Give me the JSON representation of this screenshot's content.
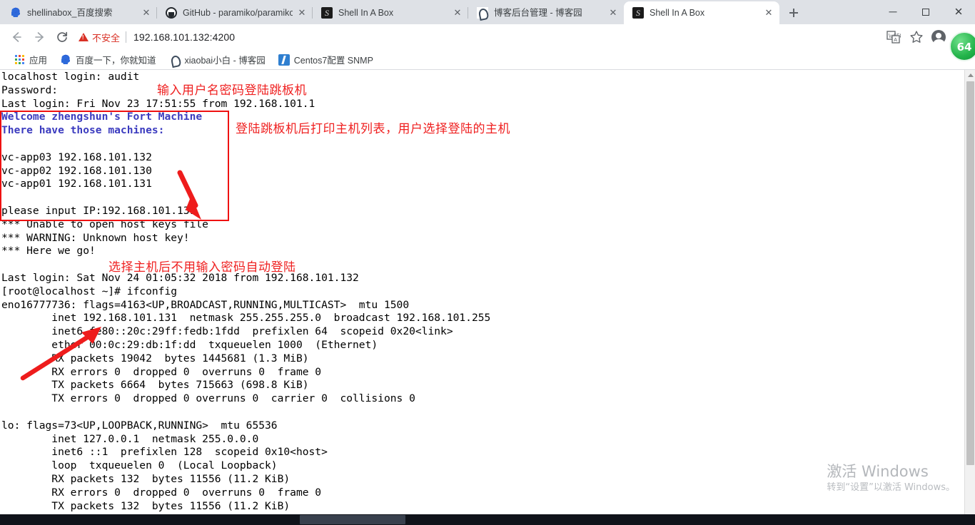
{
  "window": {
    "minimize_label": "—",
    "maximize_label": "❐",
    "close_label": "✕"
  },
  "tabs": [
    {
      "title": "shellinabox_百度搜索",
      "favicon": "baidu-icon",
      "active": false,
      "close_label": "✕"
    },
    {
      "title": "GitHub - paramiko/paramiko",
      "favicon": "github-icon",
      "active": false,
      "close_label": "✕"
    },
    {
      "title": "Shell In A Box",
      "favicon": "shellinabox-icon",
      "active": false,
      "close_label": "✕"
    },
    {
      "title": "博客后台管理 - 博客园",
      "favicon": "cnblogs-icon",
      "active": false,
      "close_label": "✕"
    },
    {
      "title": "Shell In A Box",
      "favicon": "shellinabox-icon",
      "active": true,
      "close_label": "✕"
    }
  ],
  "newtab_label": "+",
  "toolbar": {
    "back_label": "←",
    "forward_label": "→",
    "reload_label": "↻",
    "security_warning": "不安全",
    "url": "192.168.101.132:4200",
    "translate_icon": "translate-icon",
    "bookmark_icon": "star-icon",
    "profile_icon": "avatar-icon",
    "menu_icon": "three-dot-menu-icon"
  },
  "bookmarks": [
    {
      "label": "应用",
      "icon": "apps-grid-icon"
    },
    {
      "label": "百度一下，你就知道",
      "icon": "baidu-icon"
    },
    {
      "label": "xiaobai小白 - 博客园",
      "icon": "cnblogs-icon"
    },
    {
      "label": "Centos7配置 SNMP",
      "icon": "snmp-doc-icon"
    }
  ],
  "terminal": {
    "lines": [
      {
        "text": "localhost login: audit",
        "style": "plain"
      },
      {
        "text": "Password:",
        "style": "plain"
      },
      {
        "text": "Last login: Fri Nov 23 17:51:55 from 192.168.101.1",
        "style": "plain"
      },
      {
        "text": "Welcome zhengshun's Fort Machine",
        "style": "bold-blue"
      },
      {
        "text": "There have those machines:",
        "style": "bold-blue"
      },
      {
        "text": "",
        "style": "plain"
      },
      {
        "text": "vc-app03 192.168.101.132",
        "style": "plain"
      },
      {
        "text": "vc-app02 192.168.101.130",
        "style": "plain"
      },
      {
        "text": "vc-app01 192.168.101.131",
        "style": "plain"
      },
      {
        "text": "",
        "style": "plain"
      },
      {
        "text": "please input IP:192.168.101.131",
        "style": "plain"
      },
      {
        "text": "*** Unable to open host keys file",
        "style": "plain"
      },
      {
        "text": "*** WARNING: Unknown host key!",
        "style": "plain"
      },
      {
        "text": "*** Here we go!",
        "style": "plain"
      },
      {
        "text": "",
        "style": "plain"
      },
      {
        "text": "Last login: Sat Nov 24 01:05:32 2018 from 192.168.101.132",
        "style": "plain"
      },
      {
        "text": "[root@localhost ~]# ifconfig",
        "style": "plain"
      },
      {
        "text": "eno16777736: flags=4163<UP,BROADCAST,RUNNING,MULTICAST>  mtu 1500",
        "style": "plain"
      },
      {
        "text": "        inet 192.168.101.131  netmask 255.255.255.0  broadcast 192.168.101.255",
        "style": "plain"
      },
      {
        "text": "        inet6 fe80::20c:29ff:fedb:1fdd  prefixlen 64  scopeid 0x20<link>",
        "style": "plain"
      },
      {
        "text": "        ether 00:0c:29:db:1f:dd  txqueuelen 1000  (Ethernet)",
        "style": "plain"
      },
      {
        "text": "        RX packets 19042  bytes 1445681 (1.3 MiB)",
        "style": "plain"
      },
      {
        "text": "        RX errors 0  dropped 0  overruns 0  frame 0",
        "style": "plain"
      },
      {
        "text": "        TX packets 6664  bytes 715663 (698.8 KiB)",
        "style": "plain"
      },
      {
        "text": "        TX errors 0  dropped 0 overruns 0  carrier 0  collisions 0",
        "style": "plain"
      },
      {
        "text": "",
        "style": "plain"
      },
      {
        "text": "lo: flags=73<UP,LOOPBACK,RUNNING>  mtu 65536",
        "style": "plain"
      },
      {
        "text": "        inet 127.0.0.1  netmask 255.0.0.0",
        "style": "plain"
      },
      {
        "text": "        inet6 ::1  prefixlen 128  scopeid 0x10<host>",
        "style": "plain"
      },
      {
        "text": "        loop  txqueuelen 0  (Local Loopback)",
        "style": "plain"
      },
      {
        "text": "        RX packets 132  bytes 11556 (11.2 KiB)",
        "style": "plain"
      },
      {
        "text": "        RX errors 0  dropped 0  overruns 0  frame 0",
        "style": "plain"
      },
      {
        "text": "        TX packets 132  bytes 11556 (11.2 KiB)",
        "style": "plain"
      }
    ]
  },
  "annotations": [
    {
      "text": "输入用户名密码登陆跳板机"
    },
    {
      "text": "登陆跳板机后打印主机列表，用户选择登陆的主机"
    },
    {
      "text": "选择主机后不用输入密码自动登陆"
    }
  ],
  "watermark": {
    "title": "激活 Windows",
    "subtitle": "转到“设置”以激活 Windows。"
  },
  "extension_badge": {
    "label": "64"
  },
  "taskbar": {
    "clock": ""
  },
  "colors": {
    "accent_red": "#ef1111",
    "warning_red": "#d93025",
    "terminal_bold_blue": "#3b3bbf",
    "tabstrip_bg": "#dee1e6"
  }
}
